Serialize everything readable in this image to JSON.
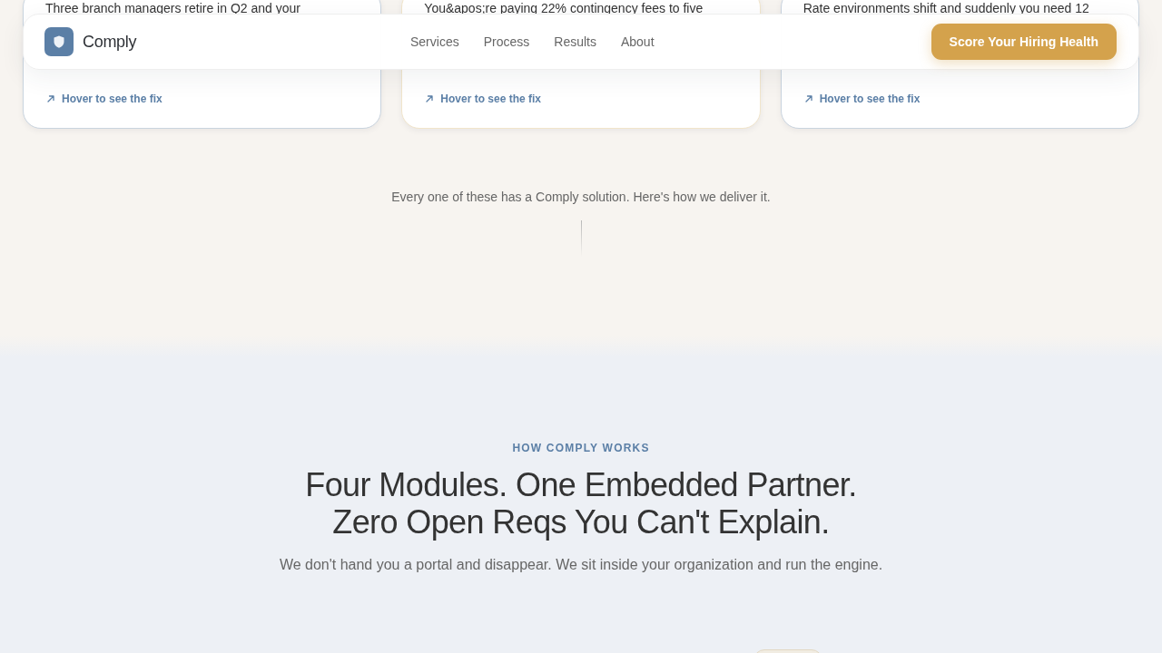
{
  "cards": [
    {
      "text": "Three branch managers retire in Q2 and your",
      "link": "Hover to see the fix",
      "color": "#c9d4df"
    },
    {
      "text": "You&apos;re paying 22% contingency fees to five",
      "link": "Hover to see the fix",
      "color": "#f1e5cb"
    },
    {
      "text": "Rate environments shift and suddenly you need 12",
      "link": "Hover to see the fix",
      "color": "#c9d4df"
    }
  ],
  "nav": {
    "brand": "Comply",
    "links": [
      "Services",
      "Process",
      "Results",
      "About"
    ],
    "cta": "Score Your Hiring Health"
  },
  "bridge_text": "Every one of these has a Comply solution. Here's how we deliver it.",
  "how_it_works": {
    "eyebrow": "HOW COMPLY WORKS",
    "headline": [
      "Four Modules. One Embedded Partner.",
      "Zero Open Reqs You Can't Explain."
    ],
    "subtitle": "We don't hand you a portal and disappear. We sit inside your organization and run the engine."
  }
}
